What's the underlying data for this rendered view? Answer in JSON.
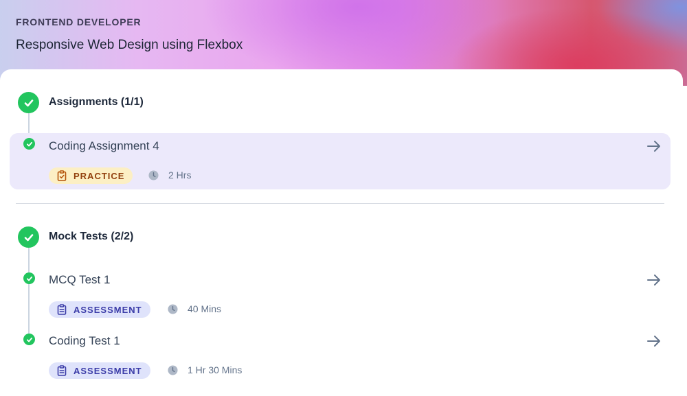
{
  "header": {
    "eyebrow": "FRONTEND DEVELOPER",
    "title": "Responsive Web Design using Flexbox"
  },
  "sections": [
    {
      "title": "Assignments (1/1)",
      "items": [
        {
          "title": "Coding Assignment 4",
          "badge": "PRACTICE",
          "duration": "2 Hrs",
          "active": true
        }
      ]
    },
    {
      "title": "Mock Tests (2/2)",
      "items": [
        {
          "title": "MCQ Test 1",
          "badge": "ASSESSMENT",
          "duration": "40 Mins",
          "active": false
        },
        {
          "title": "Coding Test 1",
          "badge": "ASSESSMENT",
          "duration": "1 Hr 30 Mins",
          "active": false
        }
      ]
    }
  ],
  "colors": {
    "success": "#22c55e",
    "active_row": "#ece9fb",
    "practice_badge_bg": "#fcefc4",
    "practice_badge_text": "#92400e",
    "assessment_badge_bg": "#dfe3fb",
    "assessment_badge_text": "#3b3ca8"
  },
  "icons": {
    "status": "check-circle-icon",
    "badge": "clipboard-icon",
    "duration": "clock-icon",
    "open": "arrow-right-icon"
  }
}
